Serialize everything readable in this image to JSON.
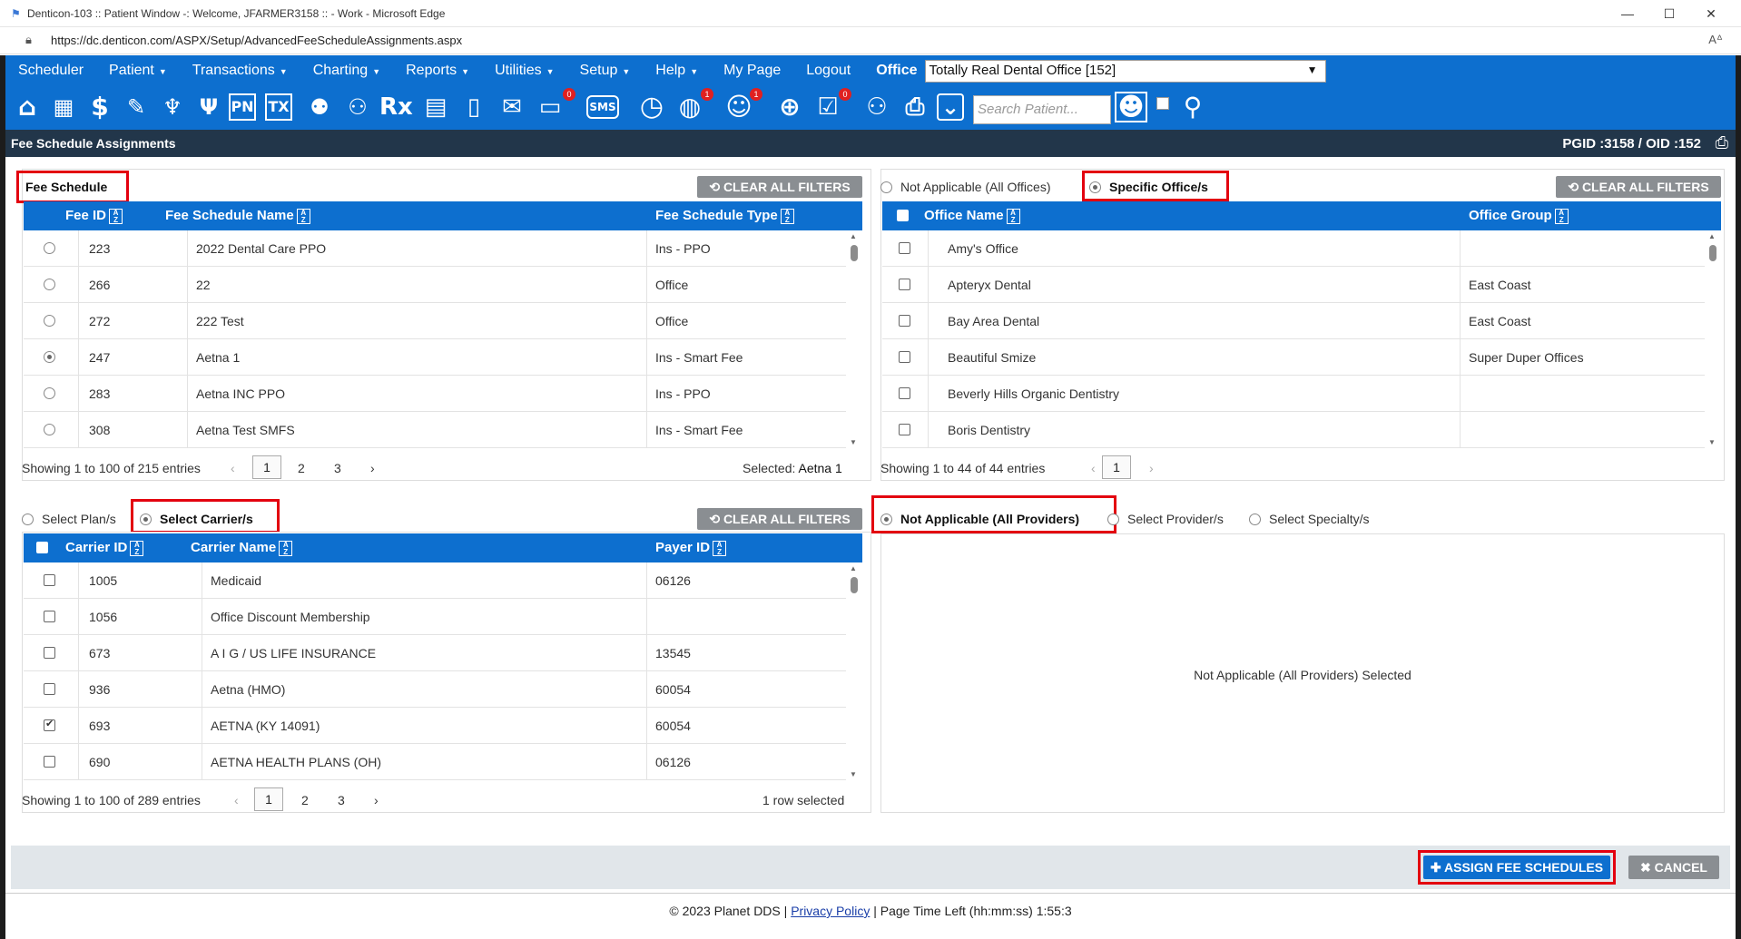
{
  "window": {
    "title": "Denticon-103 :: Patient Window -: Welcome, JFARMER3158 :: - Work - Microsoft Edge",
    "url": "https://dc.denticon.com/ASPX/Setup/AdvancedFeeScheduleAssignments.aspx"
  },
  "menu": {
    "items": [
      {
        "label": "Scheduler",
        "caret": false
      },
      {
        "label": "Patient",
        "caret": true
      },
      {
        "label": "Transactions",
        "caret": true
      },
      {
        "label": "Charting",
        "caret": true
      },
      {
        "label": "Reports",
        "caret": true
      },
      {
        "label": "Utilities",
        "caret": true
      },
      {
        "label": "Setup",
        "caret": true
      },
      {
        "label": "Help",
        "caret": true
      },
      {
        "label": "My Page",
        "caret": false
      },
      {
        "label": "Logout",
        "caret": false
      }
    ],
    "office_label": "Office",
    "office_value": "Totally Real Dental Office [152]"
  },
  "toolbar": {
    "search_placeholder": "Search Patient...",
    "pn_label": "PN",
    "tx_label": "TX",
    "rx_label": "Rx",
    "sms_label": "SMS",
    "badges": [
      "0",
      "1",
      "1",
      "0"
    ]
  },
  "page": {
    "title": "Fee Schedule Assignments",
    "ids": "PGID :3158  /  OID :152"
  },
  "fee_schedule": {
    "title": "Fee Schedule",
    "clear_label": "CLEAR ALL FILTERS",
    "headers": {
      "id": "Fee ID",
      "name": "Fee Schedule Name",
      "type": "Fee Schedule Type"
    },
    "rows": [
      {
        "id": "223",
        "name": "2022 Dental Care PPO",
        "type": "Ins - PPO",
        "selected": false
      },
      {
        "id": "266",
        "name": "22",
        "type": "Office",
        "selected": false
      },
      {
        "id": "272",
        "name": "222 Test",
        "type": "Office",
        "selected": false
      },
      {
        "id": "247",
        "name": "Aetna 1",
        "type": "Ins - Smart Fee",
        "selected": true
      },
      {
        "id": "283",
        "name": "Aetna INC PPO",
        "type": "Ins - PPO",
        "selected": false
      },
      {
        "id": "308",
        "name": "Aetna Test SMFS",
        "type": "Ins - Smart Fee",
        "selected": false
      }
    ],
    "showing": "Showing 1 to 100 of 215 entries",
    "pages": [
      "1",
      "2",
      "3"
    ],
    "selected_label": "Selected:",
    "selected_value": "Aetna 1"
  },
  "offices": {
    "opt_na": "Not Applicable (All Offices)",
    "opt_specific": "Specific Office/s",
    "clear_label": "CLEAR ALL FILTERS",
    "headers": {
      "name": "Office Name",
      "group": "Office Group"
    },
    "rows": [
      {
        "name": "Amy's Office",
        "group": ""
      },
      {
        "name": "Apteryx Dental",
        "group": "East Coast"
      },
      {
        "name": "Bay Area Dental",
        "group": "East Coast"
      },
      {
        "name": "Beautiful Smize",
        "group": "Super Duper Offices"
      },
      {
        "name": "Beverly Hills Organic Dentistry",
        "group": ""
      },
      {
        "name": "Boris Dentistry",
        "group": ""
      }
    ],
    "showing": "Showing 1 to 44 of 44 entries",
    "pages": [
      "1"
    ]
  },
  "carriers": {
    "opt_plan": "Select Plan/s",
    "opt_carrier": "Select Carrier/s",
    "clear_label": "CLEAR ALL FILTERS",
    "headers": {
      "id": "Carrier ID",
      "name": "Carrier Name",
      "payer": "Payer ID"
    },
    "rows": [
      {
        "id": "1005",
        "name": "Medicaid",
        "payer": "06126",
        "checked": false
      },
      {
        "id": "1056",
        "name": "Office Discount Membership",
        "payer": "",
        "checked": false
      },
      {
        "id": "673",
        "name": "A I G / US LIFE INSURANCE",
        "payer": "13545",
        "checked": false
      },
      {
        "id": "936",
        "name": "Aetna (HMO)",
        "payer": "60054",
        "checked": false
      },
      {
        "id": "693",
        "name": "AETNA (KY 14091)",
        "payer": "60054",
        "checked": true
      },
      {
        "id": "690",
        "name": "AETNA HEALTH PLANS (OH)",
        "payer": "06126",
        "checked": false
      }
    ],
    "showing": "Showing 1 to 100 of 289 entries",
    "pages": [
      "1",
      "2",
      "3"
    ],
    "selected_text": "1 row selected"
  },
  "providers": {
    "opt_na": "Not Applicable (All Providers)",
    "opt_provider": "Select Provider/s",
    "opt_specialty": "Select Specialty/s",
    "message": "Not Applicable (All Providers) Selected"
  },
  "footer": {
    "assign_label": "ASSIGN FEE SCHEDULES",
    "cancel_label": "CANCEL",
    "copyright": "© 2023 Planet DDS | ",
    "privacy": "Privacy Policy",
    "time_left": "|  Page Time Left (hh:mm:ss) 1:55:3"
  }
}
